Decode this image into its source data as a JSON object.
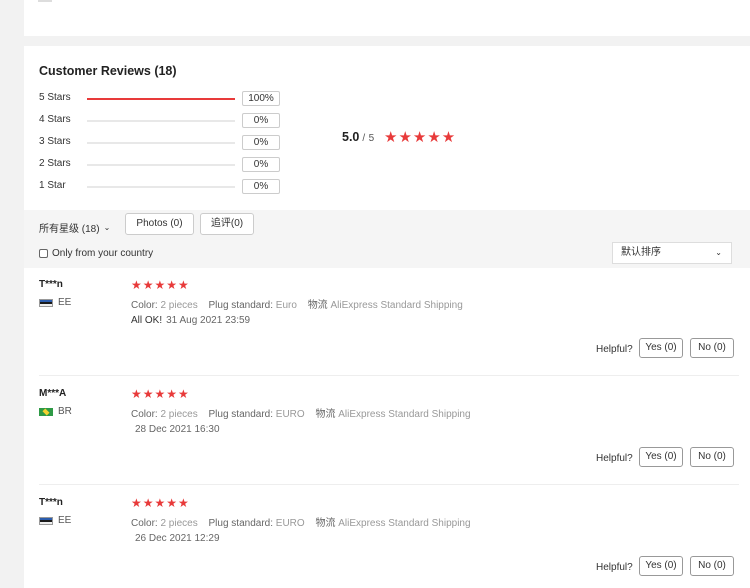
{
  "reviews_section": {
    "title": "Customer Reviews (18)",
    "histogram": [
      {
        "label": "5 Stars",
        "percent_text": "100%",
        "fraction": 1.0
      },
      {
        "label": "4 Stars",
        "percent_text": "0%",
        "fraction": 0
      },
      {
        "label": "3 Stars",
        "percent_text": "0%",
        "fraction": 0
      },
      {
        "label": "2 Stars",
        "percent_text": "0%",
        "fraction": 0
      },
      {
        "label": "1 Star",
        "percent_text": "0%",
        "fraction": 0
      }
    ],
    "average": {
      "score": "5.0",
      "separator": "/",
      "max": "5",
      "stars_text": "★★★★★"
    }
  },
  "filters": {
    "all_stars_label": "所有星级 (18)",
    "photos_label": "Photos (0)",
    "additional_label": "追评(0)",
    "country_label": "Only from your country",
    "sort_label": "默认排序"
  },
  "reviews": [
    {
      "user": "T***n",
      "country": "EE",
      "stars_text": "★★★★★",
      "color_label": "Color:",
      "color_value": "2 pieces",
      "plug_label": "Plug standard:",
      "plug_value": "Euro",
      "shipping_label": "物流",
      "shipping_value": "AliExpress Standard Shipping",
      "text": "All OK!",
      "date": "31 Aug 2021 23:59",
      "helpful_label": "Helpful?",
      "yes_label": "Yes (0)",
      "no_label": "No (0)"
    },
    {
      "user": "M***A",
      "country": "BR",
      "stars_text": "★★★★★",
      "color_label": "Color:",
      "color_value": "2 pieces",
      "plug_label": "Plug standard:",
      "plug_value": "EURO",
      "shipping_label": "物流",
      "shipping_value": "AliExpress Standard Shipping",
      "text": "",
      "date": "28 Dec 2021 16:30",
      "helpful_label": "Helpful?",
      "yes_label": "Yes (0)",
      "no_label": "No (0)"
    },
    {
      "user": "T***n",
      "country": "EE",
      "stars_text": "★★★★★",
      "color_label": "Color:",
      "color_value": "2 pieces",
      "plug_label": "Plug standard:",
      "plug_value": "EURO",
      "shipping_label": "物流",
      "shipping_value": "AliExpress Standard Shipping",
      "text": "",
      "date": "26 Dec 2021 12:29",
      "helpful_label": "Helpful?",
      "yes_label": "Yes (0)",
      "no_label": "No (0)"
    }
  ],
  "colors": {
    "accent_red": "#e83a3a",
    "page_bg": "#f2f2f2"
  },
  "icons": {
    "dropdown": "chevron-down-icon",
    "star": "star-icon",
    "flag_ee": "flag-ee-icon",
    "flag_br": "flag-br-icon"
  }
}
